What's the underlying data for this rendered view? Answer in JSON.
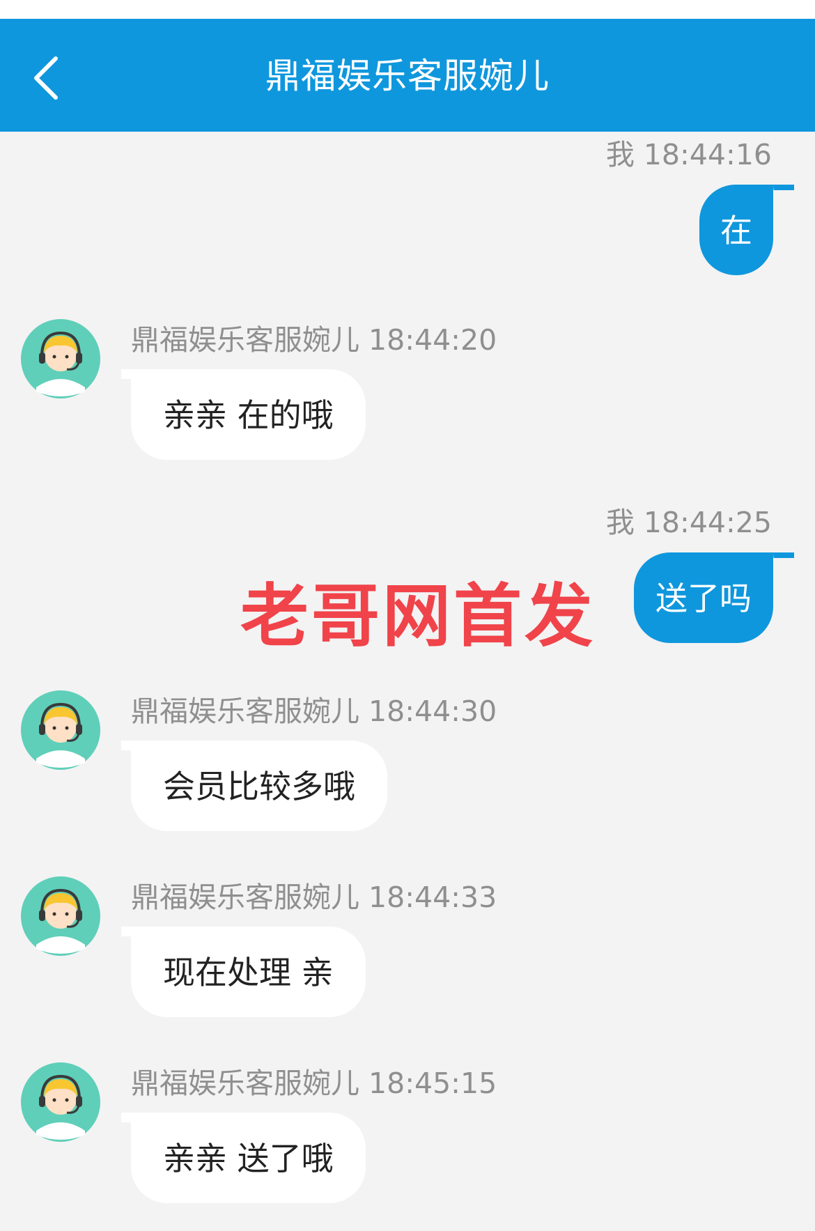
{
  "header": {
    "title": "鼎福娱乐客服婉儿",
    "back_icon": "chevron-left-icon"
  },
  "colors": {
    "header_bg": "#0f97dd",
    "my_bubble": "#0f97dd",
    "other_bubble": "#ffffff",
    "chat_bg": "#f3f3f3",
    "watermark": "#f0434a",
    "avatar_bg": "#5fcfb9"
  },
  "messages": [
    {
      "sender": "me",
      "meta": "我 18:44:16",
      "text": "在"
    },
    {
      "sender": "agent",
      "meta": "鼎福娱乐客服婉儿 18:44:20",
      "text": "亲亲 在的哦",
      "avatar_icon": "customer-service-avatar-icon"
    },
    {
      "sender": "me",
      "meta": "我 18:44:25",
      "text": "送了吗"
    },
    {
      "sender": "agent",
      "meta": "鼎福娱乐客服婉儿 18:44:30",
      "text": "会员比较多哦",
      "avatar_icon": "customer-service-avatar-icon"
    },
    {
      "sender": "agent",
      "meta": "鼎福娱乐客服婉儿 18:44:33",
      "text": "现在处理 亲",
      "avatar_icon": "customer-service-avatar-icon"
    },
    {
      "sender": "agent",
      "meta": "鼎福娱乐客服婉儿 18:45:15",
      "text": "亲亲 送了哦",
      "avatar_icon": "customer-service-avatar-icon"
    }
  ],
  "watermark": "老哥网首发"
}
